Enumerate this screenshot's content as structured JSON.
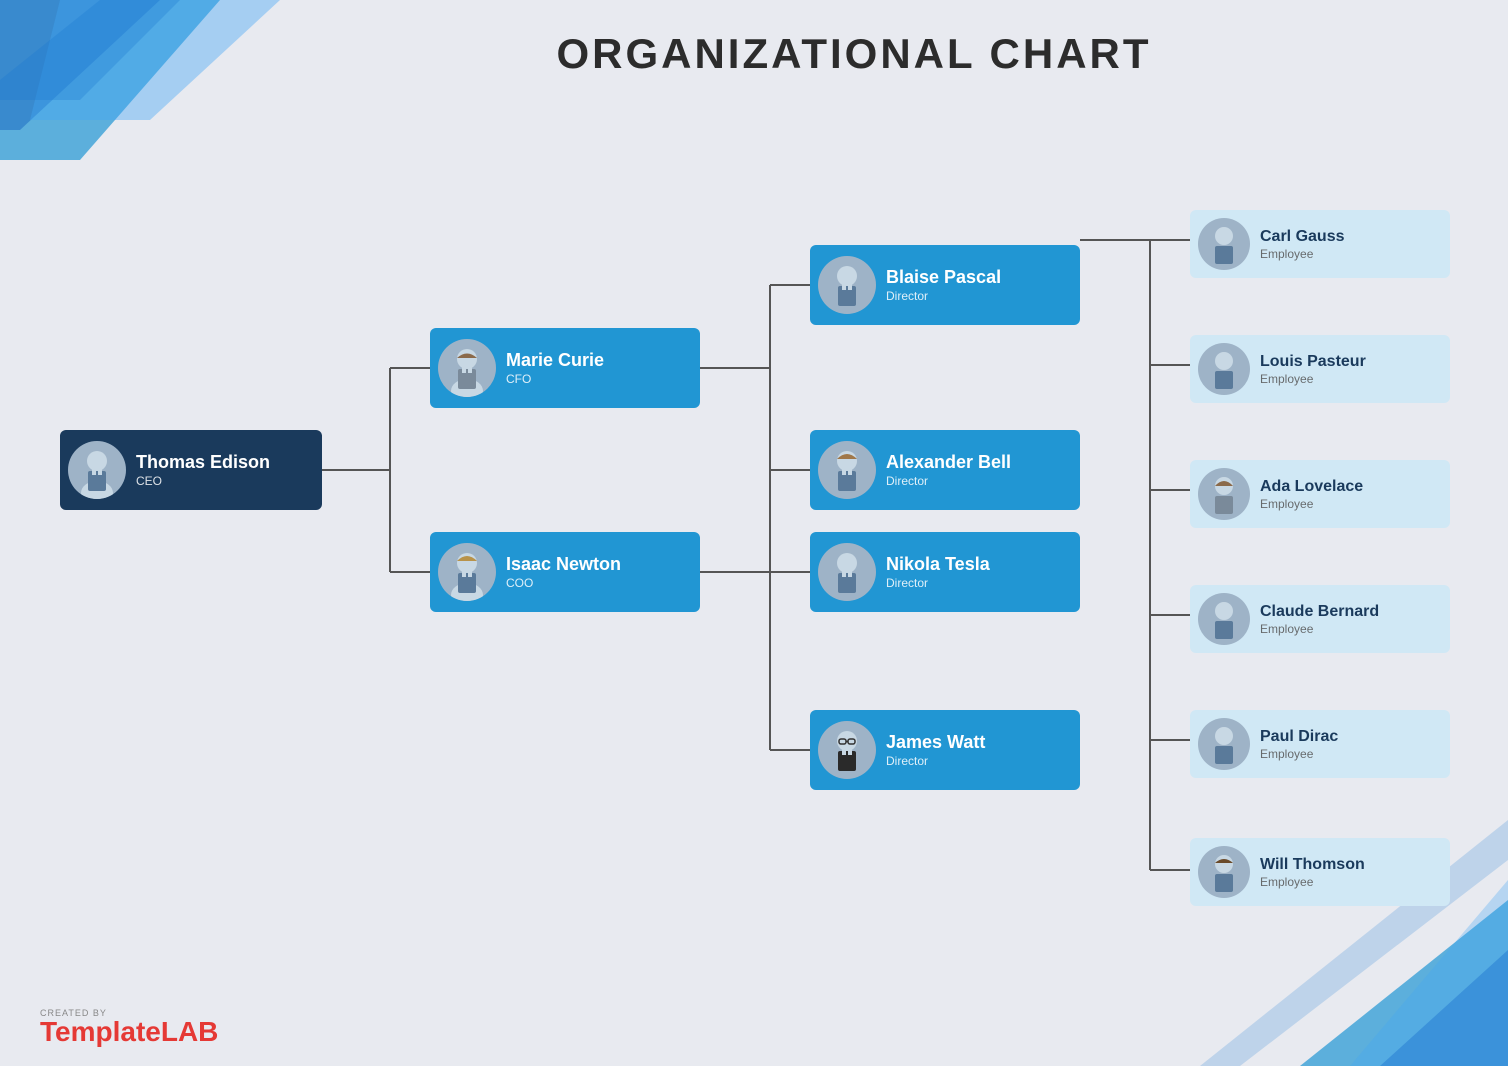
{
  "page": {
    "title": "ORGANIZATIONAL CHART",
    "background_color": "#e8eaf0"
  },
  "logo": {
    "created_by": "CREATED BY",
    "brand_light": "Template",
    "brand_bold": "LAB"
  },
  "nodes": {
    "ceo": {
      "name": "Thomas Edison",
      "title": "CEO"
    },
    "cfo": {
      "name": "Marie Curie",
      "title": "CFO"
    },
    "coo": {
      "name": "Isaac Newton",
      "title": "COO"
    },
    "directors": [
      {
        "name": "Blaise Pascal",
        "title": "Director"
      },
      {
        "name": "Alexander Bell",
        "title": "Director"
      },
      {
        "name": "Nikola Tesla",
        "title": "Director"
      },
      {
        "name": "James Watt",
        "title": "Director"
      }
    ],
    "employees": [
      {
        "name": "Carl Gauss",
        "title": "Employee"
      },
      {
        "name": "Louis Pasteur",
        "title": "Employee"
      },
      {
        "name": "Ada Lovelace",
        "title": "Employee"
      },
      {
        "name": "Claude Bernard",
        "title": "Employee"
      },
      {
        "name": "Paul Dirac",
        "title": "Employee"
      },
      {
        "name": "Will Thomson",
        "title": "Employee"
      }
    ]
  }
}
